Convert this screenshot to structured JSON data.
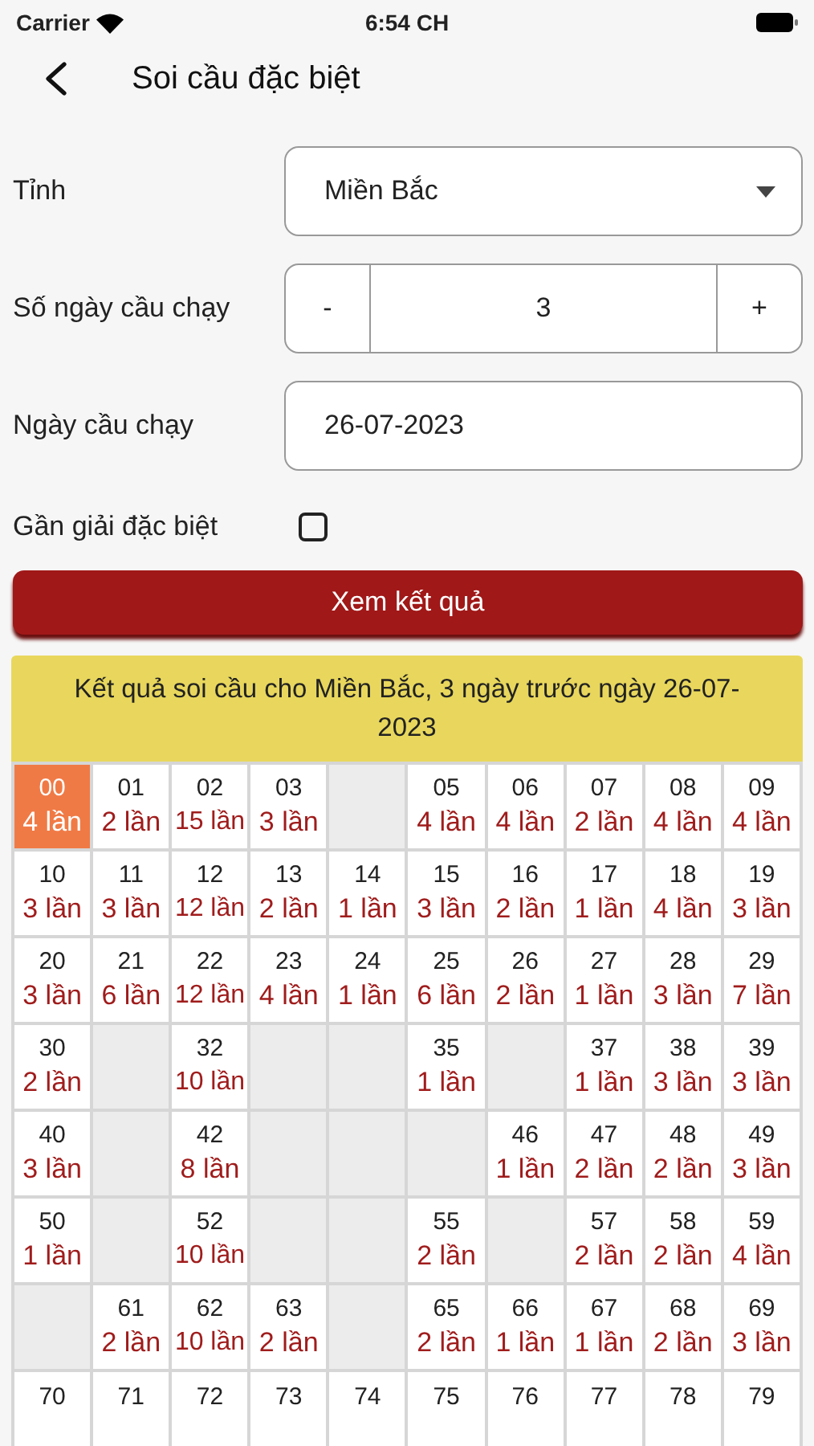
{
  "status_bar": {
    "carrier": "Carrier",
    "time": "6:54 CH"
  },
  "header": {
    "title": "Soi cầu đặc biệt"
  },
  "form": {
    "province": {
      "label": "Tỉnh",
      "value": "Miền Bắc"
    },
    "days": {
      "label": "Số ngày cầu chạy",
      "minus": "-",
      "value": "3",
      "plus": "+"
    },
    "date": {
      "label": "Ngày cầu chạy",
      "value": "26-07-2023"
    },
    "near_special": {
      "label": "Gần giải đặc biệt",
      "checked": false
    },
    "submit": "Xem kết quả"
  },
  "result": {
    "title": "Kết quả soi cầu cho Miền Bắc, 3 ngày trước ngày 26-07-2023",
    "rows": [
      [
        {
          "kind": "value",
          "number": "00",
          "count": "4 lần",
          "selected": true
        },
        {
          "kind": "value",
          "number": "01",
          "count": "2 lần",
          "selected": false
        },
        {
          "kind": "value",
          "number": "02",
          "count": "15 lần",
          "selected": false
        },
        {
          "kind": "value",
          "number": "03",
          "count": "3 lần",
          "selected": false
        },
        {
          "kind": "empty"
        },
        {
          "kind": "value",
          "number": "05",
          "count": "4 lần",
          "selected": false
        },
        {
          "kind": "value",
          "number": "06",
          "count": "4 lần",
          "selected": false
        },
        {
          "kind": "value",
          "number": "07",
          "count": "2 lần",
          "selected": false
        },
        {
          "kind": "value",
          "number": "08",
          "count": "4 lần",
          "selected": false
        },
        {
          "kind": "value",
          "number": "09",
          "count": "4 lần",
          "selected": false
        }
      ],
      [
        {
          "kind": "value",
          "number": "10",
          "count": "3 lần",
          "selected": false
        },
        {
          "kind": "value",
          "number": "11",
          "count": "3 lần",
          "selected": false
        },
        {
          "kind": "value",
          "number": "12",
          "count": "12 lần",
          "selected": false
        },
        {
          "kind": "value",
          "number": "13",
          "count": "2 lần",
          "selected": false
        },
        {
          "kind": "value",
          "number": "14",
          "count": "1 lần",
          "selected": false
        },
        {
          "kind": "value",
          "number": "15",
          "count": "3 lần",
          "selected": false
        },
        {
          "kind": "value",
          "number": "16",
          "count": "2 lần",
          "selected": false
        },
        {
          "kind": "value",
          "number": "17",
          "count": "1 lần",
          "selected": false
        },
        {
          "kind": "value",
          "number": "18",
          "count": "4 lần",
          "selected": false
        },
        {
          "kind": "value",
          "number": "19",
          "count": "3 lần",
          "selected": false
        }
      ],
      [
        {
          "kind": "value",
          "number": "20",
          "count": "3 lần",
          "selected": false
        },
        {
          "kind": "value",
          "number": "21",
          "count": "6 lần",
          "selected": false
        },
        {
          "kind": "value",
          "number": "22",
          "count": "12 lần",
          "selected": false
        },
        {
          "kind": "value",
          "number": "23",
          "count": "4 lần",
          "selected": false
        },
        {
          "kind": "value",
          "number": "24",
          "count": "1 lần",
          "selected": false
        },
        {
          "kind": "value",
          "number": "25",
          "count": "6 lần",
          "selected": false
        },
        {
          "kind": "value",
          "number": "26",
          "count": "2 lần",
          "selected": false
        },
        {
          "kind": "value",
          "number": "27",
          "count": "1 lần",
          "selected": false
        },
        {
          "kind": "value",
          "number": "28",
          "count": "3 lần",
          "selected": false
        },
        {
          "kind": "value",
          "number": "29",
          "count": "7 lần",
          "selected": false
        }
      ],
      [
        {
          "kind": "value",
          "number": "30",
          "count": "2 lần",
          "selected": false
        },
        {
          "kind": "empty"
        },
        {
          "kind": "value",
          "number": "32",
          "count": "10 lần",
          "selected": false
        },
        {
          "kind": "empty"
        },
        {
          "kind": "empty"
        },
        {
          "kind": "value",
          "number": "35",
          "count": "1 lần",
          "selected": false
        },
        {
          "kind": "empty"
        },
        {
          "kind": "value",
          "number": "37",
          "count": "1 lần",
          "selected": false
        },
        {
          "kind": "value",
          "number": "38",
          "count": "3 lần",
          "selected": false
        },
        {
          "kind": "value",
          "number": "39",
          "count": "3 lần",
          "selected": false
        }
      ],
      [
        {
          "kind": "value",
          "number": "40",
          "count": "3 lần",
          "selected": false
        },
        {
          "kind": "empty"
        },
        {
          "kind": "value",
          "number": "42",
          "count": "8 lần",
          "selected": false
        },
        {
          "kind": "empty"
        },
        {
          "kind": "empty"
        },
        {
          "kind": "empty"
        },
        {
          "kind": "value",
          "number": "46",
          "count": "1 lần",
          "selected": false
        },
        {
          "kind": "value",
          "number": "47",
          "count": "2 lần",
          "selected": false
        },
        {
          "kind": "value",
          "number": "48",
          "count": "2 lần",
          "selected": false
        },
        {
          "kind": "value",
          "number": "49",
          "count": "3 lần",
          "selected": false
        }
      ],
      [
        {
          "kind": "value",
          "number": "50",
          "count": "1 lần",
          "selected": false
        },
        {
          "kind": "empty"
        },
        {
          "kind": "value",
          "number": "52",
          "count": "10 lần",
          "selected": false
        },
        {
          "kind": "empty"
        },
        {
          "kind": "empty"
        },
        {
          "kind": "value",
          "number": "55",
          "count": "2 lần",
          "selected": false
        },
        {
          "kind": "empty"
        },
        {
          "kind": "value",
          "number": "57",
          "count": "2 lần",
          "selected": false
        },
        {
          "kind": "value",
          "number": "58",
          "count": "2 lần",
          "selected": false
        },
        {
          "kind": "value",
          "number": "59",
          "count": "4 lần",
          "selected": false
        }
      ],
      [
        {
          "kind": "empty"
        },
        {
          "kind": "value",
          "number": "61",
          "count": "2 lần",
          "selected": false
        },
        {
          "kind": "value",
          "number": "62",
          "count": "10 lần",
          "selected": false
        },
        {
          "kind": "value",
          "number": "63",
          "count": "2 lần",
          "selected": false
        },
        {
          "kind": "empty"
        },
        {
          "kind": "value",
          "number": "65",
          "count": "2 lần",
          "selected": false
        },
        {
          "kind": "value",
          "number": "66",
          "count": "1 lần",
          "selected": false
        },
        {
          "kind": "value",
          "number": "67",
          "count": "1 lần",
          "selected": false
        },
        {
          "kind": "value",
          "number": "68",
          "count": "2 lần",
          "selected": false
        },
        {
          "kind": "value",
          "number": "69",
          "count": "3 lần",
          "selected": false
        }
      ],
      [
        {
          "kind": "value",
          "number": "70",
          "selected": false
        },
        {
          "kind": "value",
          "number": "71",
          "selected": false
        },
        {
          "kind": "value",
          "number": "72",
          "selected": false
        },
        {
          "kind": "value",
          "number": "73",
          "selected": false
        },
        {
          "kind": "value",
          "number": "74",
          "selected": false
        },
        {
          "kind": "value",
          "number": "75",
          "selected": false
        },
        {
          "kind": "value",
          "number": "76",
          "selected": false
        },
        {
          "kind": "value",
          "number": "77",
          "selected": false
        },
        {
          "kind": "value",
          "number": "78",
          "selected": false
        },
        {
          "kind": "value",
          "number": "79",
          "selected": false
        }
      ]
    ]
  }
}
